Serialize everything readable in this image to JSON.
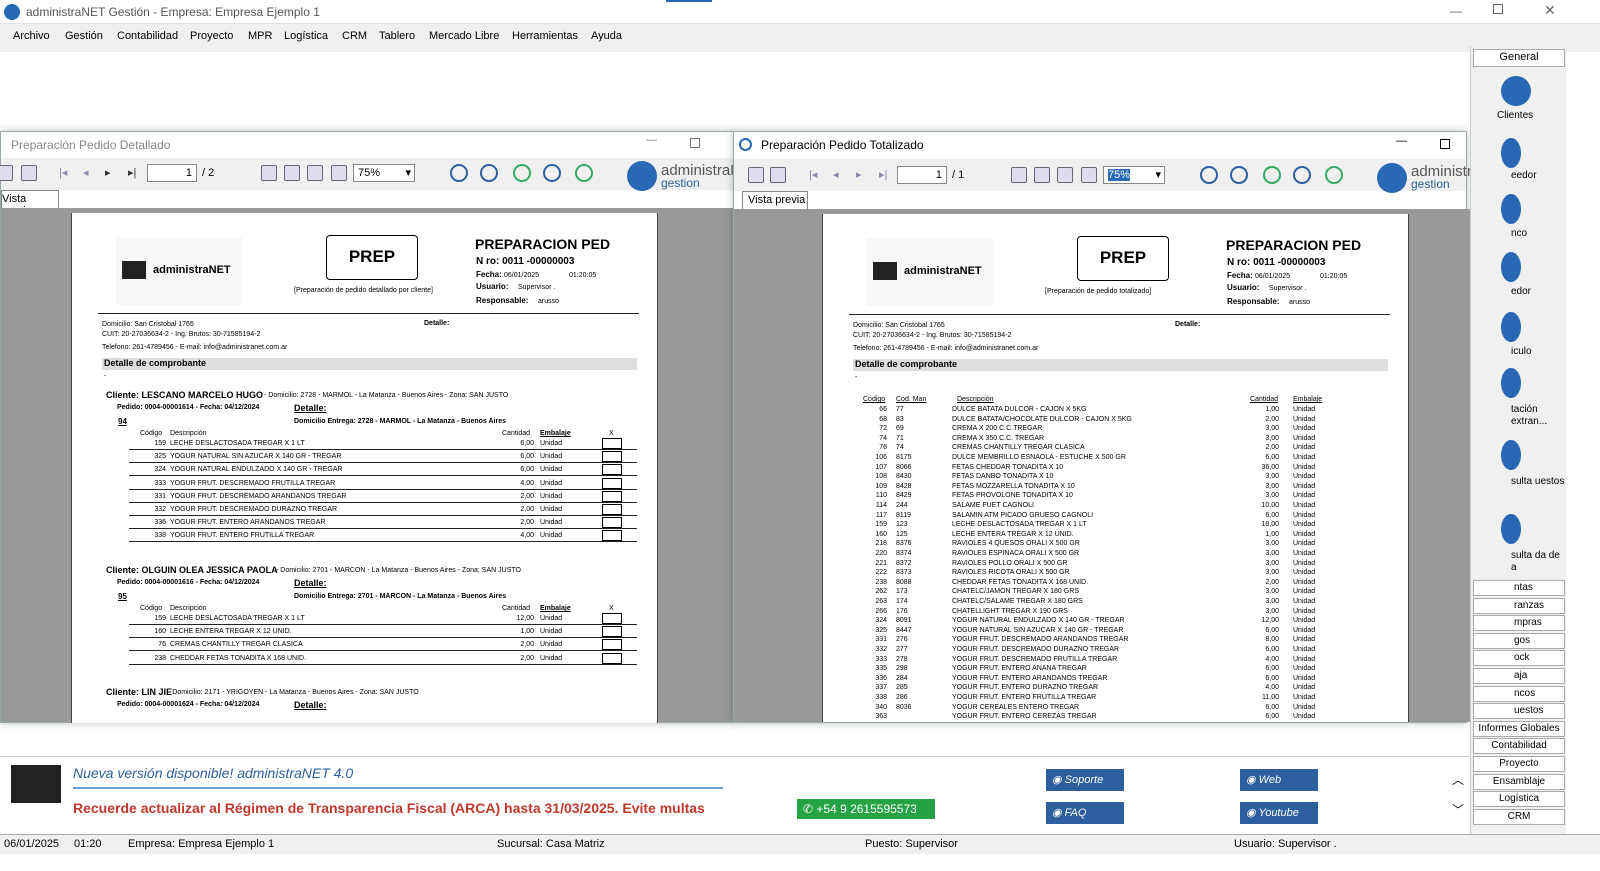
{
  "app": {
    "title": "administraNET Gestión - Empresa: Empresa Ejemplo 1"
  },
  "menu": [
    "Archivo",
    "Gestión",
    "Contabilidad",
    "Proyecto",
    "MPR",
    "Logística",
    "CRM",
    "Tablero",
    "Mercado Libre",
    "Herramientas",
    "Ayuda"
  ],
  "win1": {
    "title": "Preparación Pedido Detallado",
    "page": "1",
    "of": "/ 2",
    "zoom": "75%",
    "tab": "Vista previa"
  },
  "win2": {
    "title": "Preparación Pedido Totalizado",
    "page": "1",
    "of": "/ 1",
    "zoom": "75%",
    "tab": "Vista previa"
  },
  "logo": {
    "brand1": "administraNET",
    "brand2": "gestion"
  },
  "doc": {
    "brand": "administraNET",
    "prep": "PREP",
    "heading": "PREPARACION PED",
    "nro": "N ro: 0011 -00000003",
    "fecha_l": "Fecha:",
    "fecha": "06/01/2025",
    "hora": "01:20:05",
    "usuario_l": "Usuario:",
    "usuario": "Supervisor .",
    "resp_l": "Responsable:",
    "resp": "arusso",
    "sub1": "[Preparación de pedido detallado por cliente]",
    "sub2": "[Preparación de pedido totalizado]",
    "domicilio": "Domicilio: San Cristobal 1765",
    "cuit": "CUIT: 20-27036634-2 - Ing. Brutos: 30-71585194-2",
    "tel": "Telefono: 261-4789456 - E-mail: info@administranet.com.ar",
    "detalle": "Detalle:",
    "detalle_comp": "Detalle de comprobante",
    "dash": "-"
  },
  "clients": [
    {
      "name": "Cliente: LESCANO MARCELO HUGO",
      "addr": "- Domicilio: 2728 - MARMOL - La Matanza - Buenos Aires - Zona: SAN JUSTO",
      "pedido": "Pedido: 0004-00001614 - Fecha: 04/12/2024",
      "det": "Detalle:",
      "num": "94",
      "entrega": "Domicilio Entrega: 2728 - MARMOL - La Matanza - Buenos Aires",
      "items": [
        [
          "159",
          "LECHE DESLACTOSADA TREGAR X 1 LT",
          "6,00",
          "Unidad"
        ],
        [
          "325",
          "YOGUR NATURAL SIN AZUCAR X 140 GR - TREGAR",
          "6,00",
          "Unidad"
        ],
        [
          "324",
          "YOGUR NATURAL ENDULZADO X 140 GR - TREGAR",
          "6,00",
          "Unidad"
        ],
        [
          "333",
          "YOGUR FRUT. DESCREMADO FRUTILLA TREGAR",
          "4,00",
          "Unidad"
        ],
        [
          "331",
          "YOGUR FRUT. DESCREMADO ARANDANOS TREGAR",
          "2,00",
          "Unidad"
        ],
        [
          "332",
          "YOGUR FRUT. DESCREMADO DURAZNO TREGAR",
          "2,00",
          "Unidad"
        ],
        [
          "336",
          "YOGUR FRUT. ENTERO ARANDANOS TREGAR",
          "2,00",
          "Unidad"
        ],
        [
          "338",
          "YOGUR FRUT. ENTERO FRUTILLA TREGAR",
          "4,00",
          "Unidad"
        ]
      ]
    },
    {
      "name": "Cliente: OLGUIN OLEA JESSICA PAOLA",
      "addr": "- Domicilio: 2701 - MARCON - La Matanza - Buenos Aires - Zona: SAN JUSTO",
      "pedido": "Pedido: 0004-00001616 - Fecha: 04/12/2024",
      "det": "Detalle:",
      "num": "95",
      "entrega": "Domicilio Entrega: 2701 - MARCON - La Matanza - Buenos Aires",
      "items": [
        [
          "159",
          "LECHE DESLACTOSADA TREGAR X 1 LT",
          "12,00",
          "Unidad"
        ],
        [
          "160",
          "LECHE ENTERA TREGAR X 12 UNID.",
          "1,00",
          "Unidad"
        ],
        [
          "76",
          "CREMAS CHANTILLY TREGAR CLASICA",
          "2,00",
          "Unidad"
        ],
        [
          "238",
          "CHEDDAR FETAS TONADITA X 168 UNID.",
          "2,00",
          "Unidad"
        ]
      ]
    },
    {
      "name": "Cliente: LIN JIE",
      "addr": "- Domicilio: 2171 - YRIGOYEN - La Matanza - Buenos Aires - Zona: SAN JUSTO",
      "pedido": "Pedido: 0004-00001624 - Fecha: 04/12/2024",
      "det": "Detalle:"
    }
  ],
  "detail_headers": {
    "cod": "Código",
    "desc": "Descripción",
    "cant": "Cantidad",
    "emb": "Embalaje",
    "x": "X"
  },
  "tot_headers": {
    "cod": "Código",
    "codman": "Cod. Man",
    "desc": "Descripción",
    "cant": "Cantidad",
    "emb": "Embalaje"
  },
  "tot_items": [
    [
      "66",
      "77",
      "DULCE BATATA DULCOR - CAJON X 5KG",
      "1,00"
    ],
    [
      "68",
      "83",
      "DULCE BATATA/CHOCOLATE DULCOR - CAJON X 5KG",
      "2,00"
    ],
    [
      "72",
      "69",
      "CREMA X 200 C.C.TREGAR",
      "3,00"
    ],
    [
      "74",
      "71",
      "CREMA X 350 C.C. TREGAR",
      "3,00"
    ],
    [
      "76",
      "74",
      "CREMAS CHANTILLY TREGAR CLASICA",
      "2,00"
    ],
    [
      "106",
      "8175",
      "DULCE MEMBRILLO ESNAOLA - ESTUCHE X 500 GR",
      "6,00"
    ],
    [
      "107",
      "8066",
      "FETAS CHEDDAR TONADITA X 10",
      "36,00"
    ],
    [
      "108",
      "8430",
      "FETAS DANBO TONADITA X 10",
      "3,00"
    ],
    [
      "109",
      "8428",
      "FETAS MOZZARELLA TONADITA X 10",
      "3,00"
    ],
    [
      "110",
      "8429",
      "FETAS PROVOLONE TONADITA X 10",
      "3,00"
    ],
    [
      "114",
      "244",
      "SALAME FUET CAGNOLI",
      "10,00"
    ],
    [
      "117",
      "8119",
      "SALAMIN ATM PICADO GRUESO CAGNOLI",
      "6,00"
    ],
    [
      "159",
      "123",
      "LECHE DESLACTOSADA TREGAR X 1 LT",
      "18,00"
    ],
    [
      "160",
      "125",
      "LECHE ENTERA TREGAR X 12 UNID.",
      "1,00"
    ],
    [
      "218",
      "8376",
      "RAVIOLES 4 QUESOS ORALI X 500 GR",
      "3,00"
    ],
    [
      "220",
      "8374",
      "RAVIOLES ESPINACA ORALI X 500 GR",
      "3,00"
    ],
    [
      "221",
      "8372",
      "RAVIOLES POLLO ORALI X 500 GR",
      "3,00"
    ],
    [
      "222",
      "8373",
      "RAVIOLES RICOTA ORALI X 500 GR",
      "3,00"
    ],
    [
      "238",
      "8088",
      "CHEDDAR FETAS TONADITA X 168 UNID.",
      "2,00"
    ],
    [
      "262",
      "173",
      "CHATELC/JAMON TREGAR X 180 GRS",
      "3,00"
    ],
    [
      "263",
      "174",
      "CHATELC/SALAME TREGAR X 180 GRS",
      "3,00"
    ],
    [
      "266",
      "176",
      "CHATELLIGHT TREGAR X 190 GRS",
      "3,00"
    ],
    [
      "324",
      "8091",
      "YOGUR NATURAL ENDULZADO X 140 GR - TREGAR",
      "12,00"
    ],
    [
      "325",
      "8447",
      "YOGUR NATURAL SIN AZUCAR X 140 GR - TREGAR",
      "6,00"
    ],
    [
      "331",
      "276",
      "YOGUR FRUT. DESCREMADO ARANDANOS TREGAR",
      "8,00"
    ],
    [
      "332",
      "277",
      "YOGUR FRUT. DESCREMADO DURAZNO TREGAR",
      "6,00"
    ],
    [
      "333",
      "278",
      "YOGUR FRUT. DESCREMADO FRUTILLA TREGAR",
      "4,00"
    ],
    [
      "335",
      "298",
      "YOGUR FRUT. ENTERO ANANA TREGAR",
      "6,00"
    ],
    [
      "336",
      "284",
      "YOGUR FRUT. ENTERO ARANDANOS TREGAR",
      "6,00"
    ],
    [
      "337",
      "285",
      "YOGUR FRUT. ENTERO DURAZNO TREGAR",
      "4,00"
    ],
    [
      "338",
      "286",
      "YOGUR FRUT. ENTERO FRUTILLA TREGAR",
      "11,00"
    ],
    [
      "340",
      "8036",
      "YOGUR CEREALES ENTERO TREGAR",
      "6,00"
    ],
    [
      "363",
      "",
      "YOGUR FRUT. ENTERO CEREZAS TREGAR",
      "6,00"
    ]
  ],
  "unidad": "Unidad",
  "right": {
    "general": "General",
    "icons": [
      "Clientes",
      "eedor",
      "nco",
      "edor",
      "iculo",
      "tación extran...",
      "sulta uestos",
      "sulta da de a"
    ],
    "buttons": [
      "ntas",
      "ranzas",
      "mpras",
      "gos",
      "ock",
      "aja",
      "ncos",
      "uestos",
      "Informes Globales",
      "Contabilidad",
      "Proyecto",
      "Ensamblaje",
      "Logística",
      "CRM"
    ]
  },
  "bottom": {
    "title": "Nueva versión disponible! administraNET 4.0",
    "notice": "Recuerde actualizar al Régimen de Transparencia Fiscal (ARCA) hasta 31/03/2025. Evite multas",
    "whatsapp": "+54 9 2615595573",
    "soporte": "Soporte",
    "faq": "FAQ",
    "web": "Web",
    "youtube": "Youtube"
  },
  "status": {
    "fecha": "06/01/2025",
    "hora": "01:20",
    "empresa": "Empresa: Empresa Ejemplo 1",
    "sucursal": "Sucursal: Casa Matriz",
    "puesto": "Puesto: Supervisor",
    "usuario": "Usuario: Supervisor ."
  },
  "colors": {
    "accent": "#2d5f9e",
    "notice": "#c0392b",
    "whatsapp": "#25a244"
  }
}
